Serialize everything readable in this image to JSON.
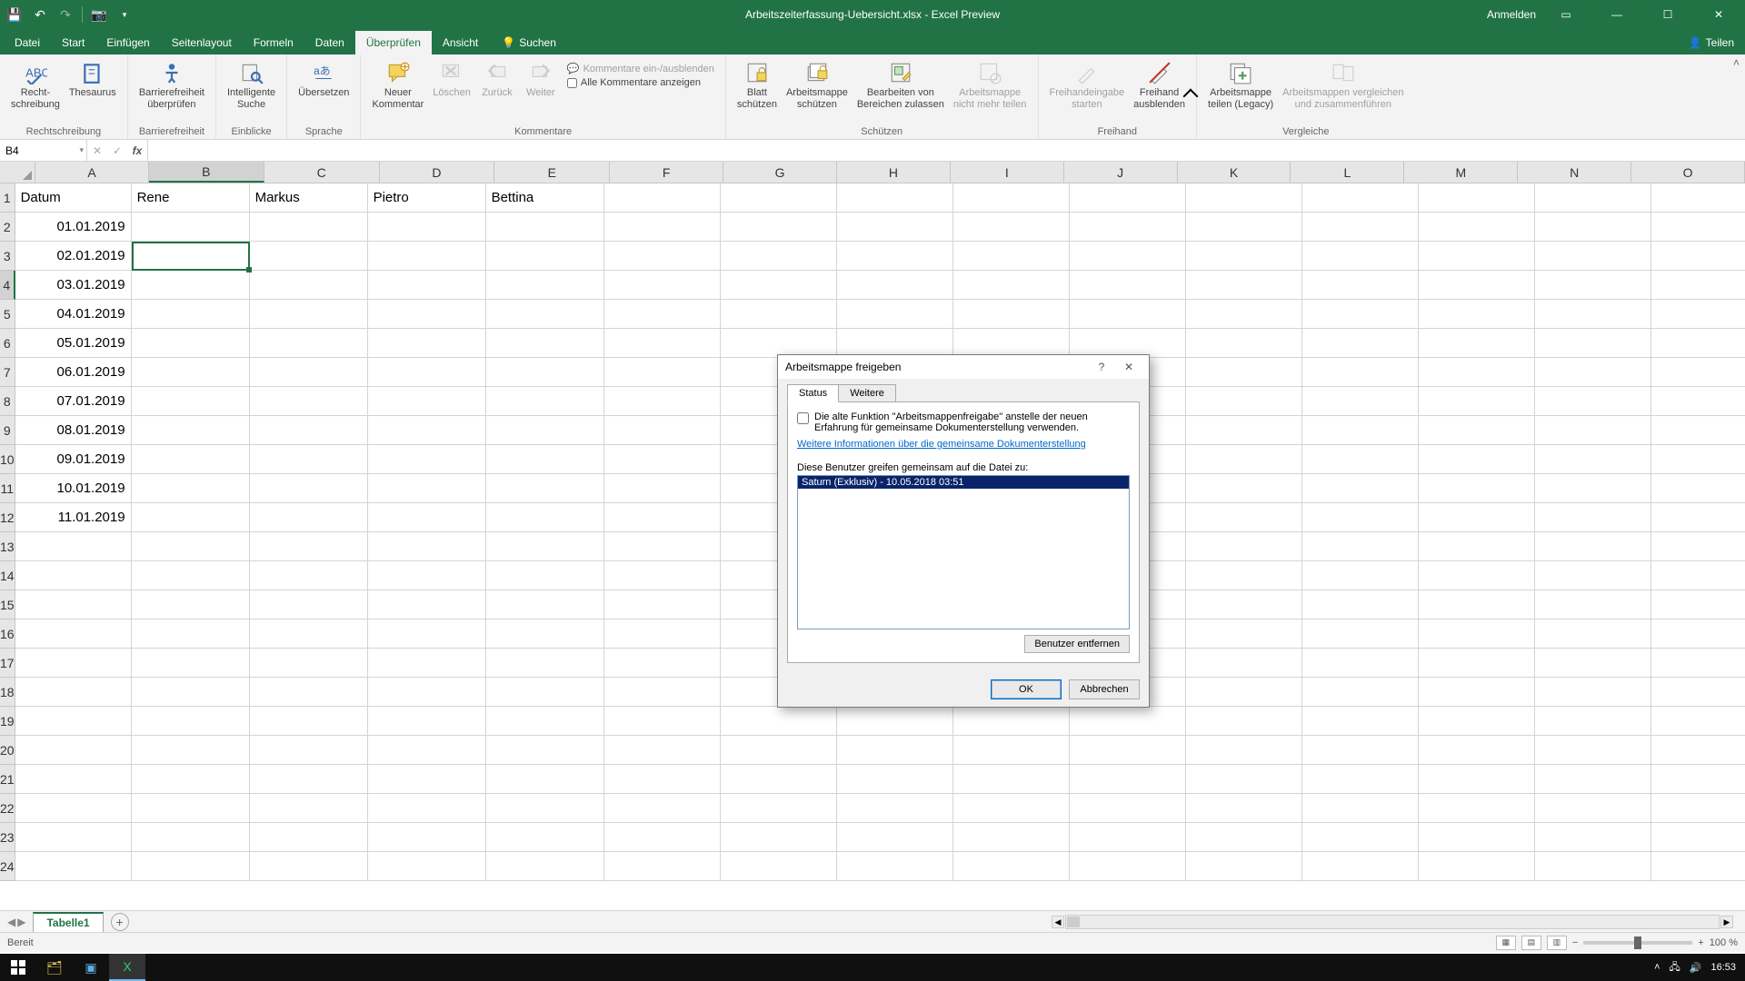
{
  "title": "Arbeitszeiterfassung-Uebersicht.xlsx - Excel Preview",
  "auth": {
    "signin": "Anmelden"
  },
  "tabs": {
    "file": "Datei",
    "start": "Start",
    "insert": "Einfügen",
    "layout": "Seitenlayout",
    "formulas": "Formeln",
    "data": "Daten",
    "review": "Überprüfen",
    "view": "Ansicht",
    "search": "Suchen",
    "share": "Teilen"
  },
  "ribbon": {
    "spelling": "Recht-\nschreibung",
    "thesaurus": "Thesaurus",
    "proofing_group": "Rechtschreibung",
    "acc_check": "Barrierefreiheit\nüberprüfen",
    "acc_group": "Barrierefreiheit",
    "smart_lookup": "Intelligente\nSuche",
    "insights_group": "Einblicke",
    "translate": "Übersetzen",
    "language_group": "Sprache",
    "new_comment": "Neuer\nKommentar",
    "delete": "Löschen",
    "prev": "Zurück",
    "next": "Weiter",
    "toggle_comments": "Kommentare ein-/ausblenden",
    "show_all_comments": "Alle Kommentare anzeigen",
    "comments_group": "Kommentare",
    "protect_sheet": "Blatt\nschützen",
    "protect_wb": "Arbeitsmappe\nschützen",
    "allow_ranges": "Bearbeiten von\nBereichen zulassen",
    "unshare": "Arbeitsmappe\nnicht mehr teilen",
    "protect_group": "Schützen",
    "ink_start": "Freihandeingabe\nstarten",
    "ink_hide": "Freihand\nausblenden",
    "ink_group": "Freihand",
    "share_legacy": "Arbeitsmappe\nteilen (Legacy)",
    "compare_merge": "Arbeitsmappen vergleichen\nund zusammenführen",
    "compare_group": "Vergleiche"
  },
  "namebox": "B4",
  "columns": [
    "A",
    "B",
    "C",
    "D",
    "E",
    "F",
    "G",
    "H",
    "I",
    "J",
    "K",
    "L",
    "M",
    "N",
    "O"
  ],
  "header_row": {
    "A": "Datum",
    "B": "Rene",
    "C": "Markus",
    "D": "Pietro",
    "E": "Bettina"
  },
  "dates": [
    "01.01.2019",
    "02.01.2019",
    "03.01.2019",
    "04.01.2019",
    "05.01.2019",
    "06.01.2019",
    "07.01.2019",
    "08.01.2019",
    "09.01.2019",
    "10.01.2019",
    "11.01.2019"
  ],
  "sheet_tab": "Tabelle1",
  "status": "Bereit",
  "zoom": "100 %",
  "dialog": {
    "title": "Arbeitsmappe freigeben",
    "tab_status": "Status",
    "tab_more": "Weitere",
    "checkbox_text": "Die alte Funktion \"Arbeitsmappenfreigabe\" anstelle der neuen Erfahrung für gemeinsame Dokumenterstellung verwenden.",
    "link": "Weitere Informationen über die gemeinsame Dokumenterstellung",
    "users_label": "Diese Benutzer greifen gemeinsam auf die Datei zu:",
    "user_item": "Saturn (Exklusiv) - 10.05.2018 03:51",
    "remove_user": "Benutzer entfernen",
    "ok": "OK",
    "cancel": "Abbrechen"
  },
  "time": "16:53"
}
